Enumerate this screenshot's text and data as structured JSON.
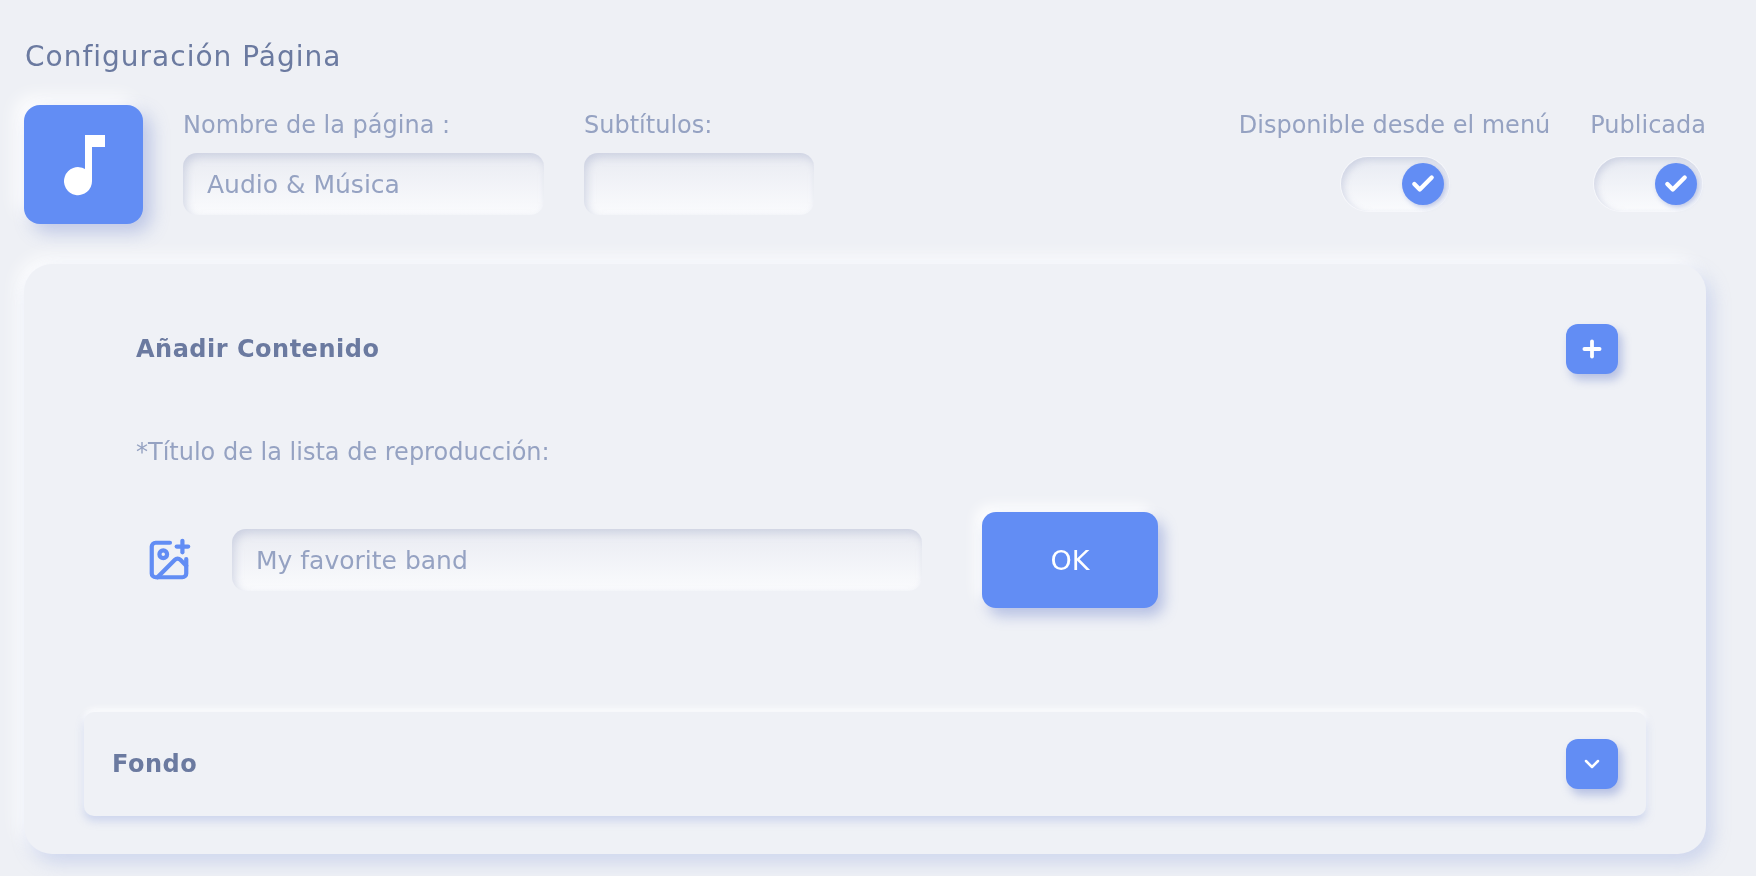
{
  "page_title": "Configuración Página",
  "fields": [
    {
      "label": "Nombre de la página :",
      "value": "Audio & Música"
    },
    {
      "label": "Subtítulos:"
    }
  ],
  "toggles": [
    {
      "label": "Disponible desde el menú",
      "checked": true
    },
    {
      "label": "Publicada",
      "checked": true
    }
  ],
  "content_section": {
    "title": "Añadir Contenido",
    "field_label": "*Título de la lista de reproducción:",
    "placeholder": "My favorite band",
    "button": "OK"
  },
  "background_section": {
    "title": "Fondo",
    "expanded": false
  }
}
